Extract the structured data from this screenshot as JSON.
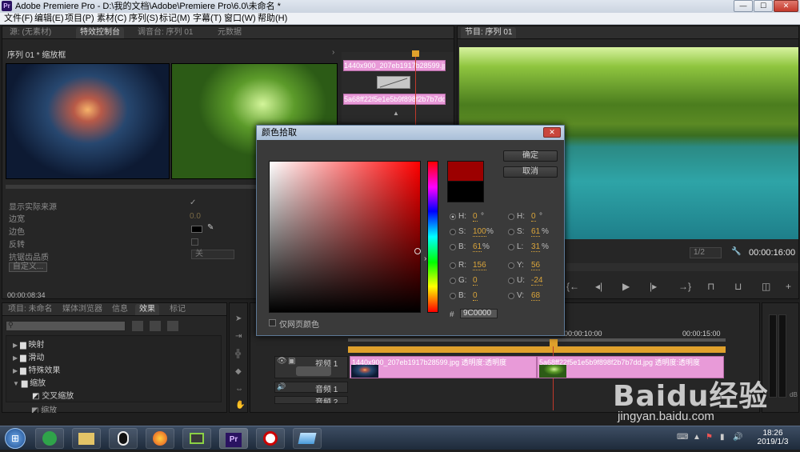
{
  "window": {
    "title": "Adobe Premiere Pro - D:\\我的文档\\Adobe\\Premiere Pro\\6.0\\未命名 *",
    "app_logo": "Pr",
    "minimize": "—",
    "maximize": "☐",
    "close": "✕"
  },
  "menu": [
    "文件(F)",
    "编辑(E)",
    "项目(P)",
    "素材(C)",
    "序列(S)",
    "标记(M)",
    "字幕(T)",
    "窗口(W)",
    "帮助(H)"
  ],
  "source_panel": {
    "tabs": [
      "源: (无素材)",
      "特效控制台",
      "调音台: 序列 01",
      "元数据"
    ],
    "header": "序列 01 * 缩放框",
    "timecode": "00:00:08:34",
    "clip_label_top": "1440x900_207eb1917b28599.jpg",
    "clip_label_bottom": "5a68ff22f5e1e5b9f898f2b7b7dd",
    "properties": [
      {
        "label": "显示实际来源",
        "value": "✓"
      },
      {
        "label": "边宽",
        "value": "0.0"
      },
      {
        "label": "边色",
        "value": ""
      },
      {
        "label": "反转",
        "value": ""
      },
      {
        "label": "抗锯齿品质",
        "value": "关"
      }
    ],
    "custom_button": "自定义..."
  },
  "program_panel": {
    "tab": "节目: 序列 01",
    "zoom": "1/2",
    "timecode": "00:00:16:00"
  },
  "project_panel": {
    "tabs": [
      "项目: 未命名",
      "媒体浏览器",
      "信息",
      "效果",
      "标记"
    ],
    "search_placeholder": "",
    "items": [
      {
        "label": "映射",
        "expanded": false
      },
      {
        "label": "滑动",
        "expanded": false
      },
      {
        "label": "特殊效果",
        "expanded": false
      },
      {
        "label": "缩放",
        "expanded": true
      },
      {
        "label": "交叉缩放",
        "child": true
      },
      {
        "label": "缩放",
        "child": true
      }
    ]
  },
  "timeline": {
    "ruler": [
      "00:00:10:00",
      "00:00:15:00"
    ],
    "video_track": "视频 1",
    "audio_track": "音频 1",
    "audio_track2": "音频 2",
    "clip1": "1440x900_207eb1917b28599.jpg 透明度:透明度",
    "clip2": "5a68ff22f5e1e5b9f898f2b7b7dd.jpg 透明度:透明度"
  },
  "color_dialog": {
    "title": "颜色拾取",
    "ok": "确定",
    "cancel": "取消",
    "web_colors_label": "仅网页颜色",
    "hex_label": "#",
    "hex": "9C0000",
    "new_color": "#9c0000",
    "old_color": "#000000",
    "left_fields": [
      {
        "label": "H:",
        "value": "0",
        "unit": "°",
        "selected": true
      },
      {
        "label": "S:",
        "value": "100",
        "unit": "%",
        "selected": false
      },
      {
        "label": "B:",
        "value": "61",
        "unit": "%",
        "selected": false
      },
      {
        "label": "R:",
        "value": "156",
        "unit": "",
        "selected": false
      },
      {
        "label": "G:",
        "value": "0",
        "unit": "",
        "selected": false
      },
      {
        "label": "B:",
        "value": "0",
        "unit": "",
        "selected": false
      }
    ],
    "right_fields": [
      {
        "label": "H:",
        "value": "0",
        "unit": "°"
      },
      {
        "label": "S:",
        "value": "61",
        "unit": "%"
      },
      {
        "label": "L:",
        "value": "31",
        "unit": "%"
      },
      {
        "label": "Y:",
        "value": "56",
        "unit": ""
      },
      {
        "label": "U:",
        "value": "-24",
        "unit": ""
      },
      {
        "label": "V:",
        "value": "68",
        "unit": ""
      }
    ]
  },
  "taskbar": {
    "start": "⊞",
    "icons": [
      "360-icon",
      "folder-icon",
      "qq-icon",
      "firefox-icon",
      "video-editor-icon",
      "premiere-icon",
      "record-icon",
      "app-icon"
    ],
    "premiere_label": "Pr",
    "time": "18:26",
    "date": "2019/1/3"
  },
  "watermark": {
    "brand": "Baidu经验",
    "url": "jingyan.baidu.com"
  }
}
